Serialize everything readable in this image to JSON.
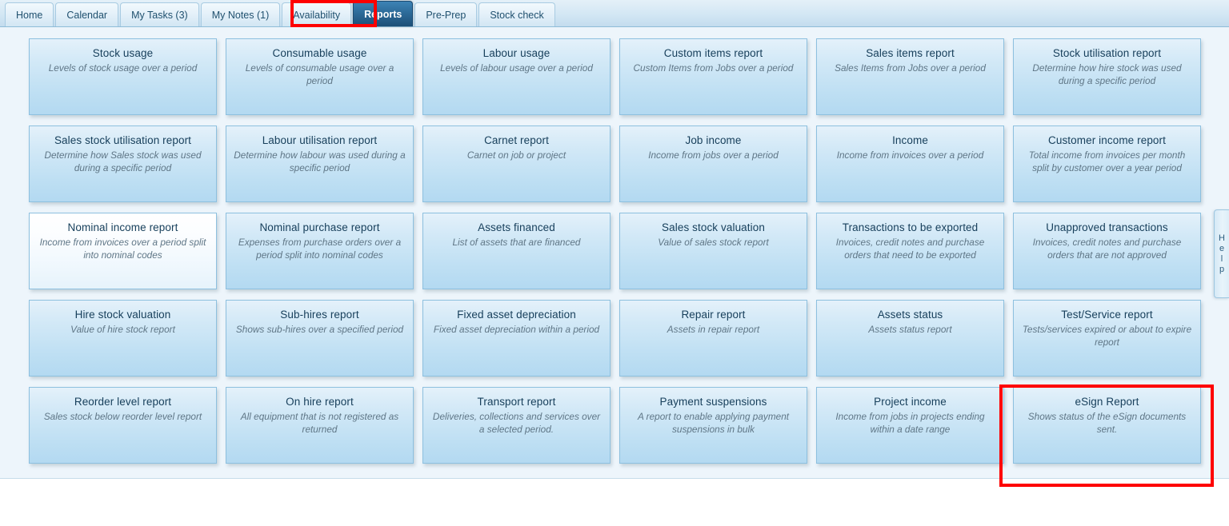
{
  "tabs": [
    {
      "label": "Home",
      "active": false
    },
    {
      "label": "Calendar",
      "active": false
    },
    {
      "label": "My Tasks (3)",
      "active": false
    },
    {
      "label": "My Notes (1)",
      "active": false
    },
    {
      "label": "Availability",
      "active": false
    },
    {
      "label": "Reports",
      "active": true
    },
    {
      "label": "Pre-Prep",
      "active": false
    },
    {
      "label": "Stock check",
      "active": false
    }
  ],
  "help_tab": {
    "letters": [
      "H",
      "e",
      "l",
      "p"
    ],
    "label": "Help"
  },
  "colors": {
    "accent": "#1d4f77",
    "annotation": "#fe0000",
    "card_border": "#8dc0df",
    "panel_bg": "#edf5fb",
    "title_text": "#18405c",
    "desc_text": "#5f7686"
  },
  "annotations": [
    {
      "name": "reports-tab-highlight",
      "target": "Reports"
    },
    {
      "name": "esign-report-highlight",
      "target": "eSign Report"
    }
  ],
  "report_rows": [
    [
      {
        "title": "Stock usage",
        "desc": "Levels of stock usage over a period",
        "state": "normal"
      },
      {
        "title": "Consumable usage",
        "desc": "Levels of consumable usage over a period",
        "state": "normal"
      },
      {
        "title": "Labour usage",
        "desc": "Levels of labour usage over a period",
        "state": "normal"
      },
      {
        "title": "Custom items report",
        "desc": "Custom Items from Jobs over a period",
        "state": "normal"
      },
      {
        "title": "Sales items report",
        "desc": "Sales Items from Jobs over a period",
        "state": "normal"
      },
      {
        "title": "Stock utilisation report",
        "desc": "Determine how hire stock was used during a specific period",
        "state": "normal"
      }
    ],
    [
      {
        "title": "Sales stock utilisation report",
        "desc": "Determine how Sales stock was used during a specific period",
        "state": "normal"
      },
      {
        "title": "Labour utilisation report",
        "desc": "Determine how labour was used during a specific period",
        "state": "normal"
      },
      {
        "title": "Carnet report",
        "desc": "Carnet on job or project",
        "state": "normal"
      },
      {
        "title": "Job income",
        "desc": "Income from jobs over a period",
        "state": "normal"
      },
      {
        "title": "Income",
        "desc": "Income from invoices over a period",
        "state": "normal"
      },
      {
        "title": "Customer income report",
        "desc": "Total income from invoices per month split by customer over a year period",
        "state": "normal"
      }
    ],
    [
      {
        "title": "Nominal income report",
        "desc": "Income from invoices over a period split into nominal codes",
        "state": "hovered"
      },
      {
        "title": "Nominal purchase report",
        "desc": "Expenses from purchase orders over a period split into nominal codes",
        "state": "normal"
      },
      {
        "title": "Assets financed",
        "desc": "List of assets that are financed",
        "state": "normal"
      },
      {
        "title": "Sales stock valuation",
        "desc": "Value of sales stock report",
        "state": "normal"
      },
      {
        "title": "Transactions to be exported",
        "desc": "Invoices, credit notes and purchase orders that need to be exported",
        "state": "normal"
      },
      {
        "title": "Unapproved transactions",
        "desc": "Invoices, credit notes and purchase orders that are not approved",
        "state": "normal"
      }
    ],
    [
      {
        "title": "Hire stock valuation",
        "desc": "Value of hire stock report",
        "state": "normal"
      },
      {
        "title": "Sub-hires report",
        "desc": "Shows sub-hires over a specified period",
        "state": "normal"
      },
      {
        "title": "Fixed asset depreciation",
        "desc": "Fixed asset depreciation within a period",
        "state": "normal"
      },
      {
        "title": "Repair report",
        "desc": "Assets in repair report",
        "state": "normal"
      },
      {
        "title": "Assets status",
        "desc": "Assets status report",
        "state": "normal"
      },
      {
        "title": "Test/Service report",
        "desc": "Tests/services expired or about to expire report",
        "state": "normal"
      }
    ],
    [
      {
        "title": "Reorder level report",
        "desc": "Sales stock below reorder level report",
        "state": "normal"
      },
      {
        "title": "On hire report",
        "desc": "All equipment that is not registered as returned",
        "state": "normal"
      },
      {
        "title": "Transport report",
        "desc": "Deliveries, collections and services over a selected period.",
        "state": "normal"
      },
      {
        "title": "Payment suspensions",
        "desc": "A report to enable applying payment suspensions in bulk",
        "state": "normal"
      },
      {
        "title": "Project income",
        "desc": "Income from jobs in projects ending within a date range",
        "state": "normal"
      },
      {
        "title": "eSign Report",
        "desc": "Shows status of the eSign documents sent.",
        "state": "normal"
      }
    ]
  ]
}
